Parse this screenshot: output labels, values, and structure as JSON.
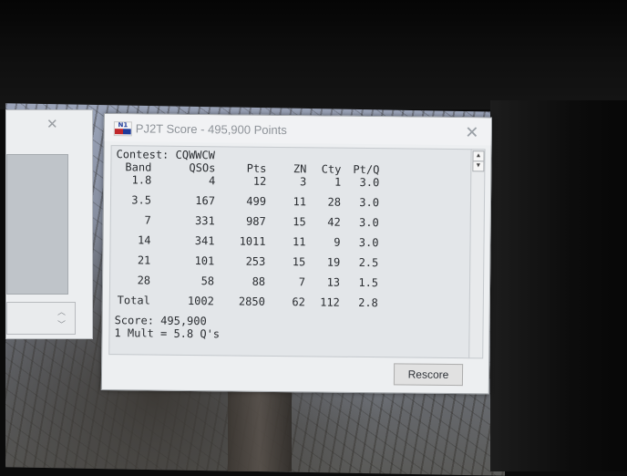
{
  "window": {
    "title": "PJ2T Score - 495,900 Points",
    "icon_text": "N1"
  },
  "score": {
    "contest_line": "Contest: CQWWCW",
    "headers": [
      "Band",
      "QSOs",
      "Pts",
      "ZN",
      "Cty",
      "Pt/Q"
    ],
    "rows": [
      [
        "1.8",
        "4",
        "12",
        "3",
        "1",
        "3.0"
      ],
      [
        "3.5",
        "167",
        "499",
        "11",
        "28",
        "3.0"
      ],
      [
        "7",
        "331",
        "987",
        "15",
        "42",
        "3.0"
      ],
      [
        "14",
        "341",
        "1011",
        "11",
        "9",
        "3.0"
      ],
      [
        "21",
        "101",
        "253",
        "15",
        "19",
        "2.5"
      ],
      [
        "28",
        "58",
        "88",
        "7",
        "13",
        "1.5"
      ],
      [
        "Total",
        "1002",
        "2850",
        "62",
        "112",
        "2.8"
      ]
    ],
    "score_line": "Score: 495,900",
    "mult_line": "1 Mult = 5.8 Q's"
  },
  "buttons": {
    "rescore": "Rescore"
  },
  "scrollbar": {
    "up": "▲",
    "down": "▼"
  },
  "background_window": {
    "close": "✕"
  },
  "icons": {
    "app": "n1mm-logo-icon",
    "close": "close-icon"
  }
}
